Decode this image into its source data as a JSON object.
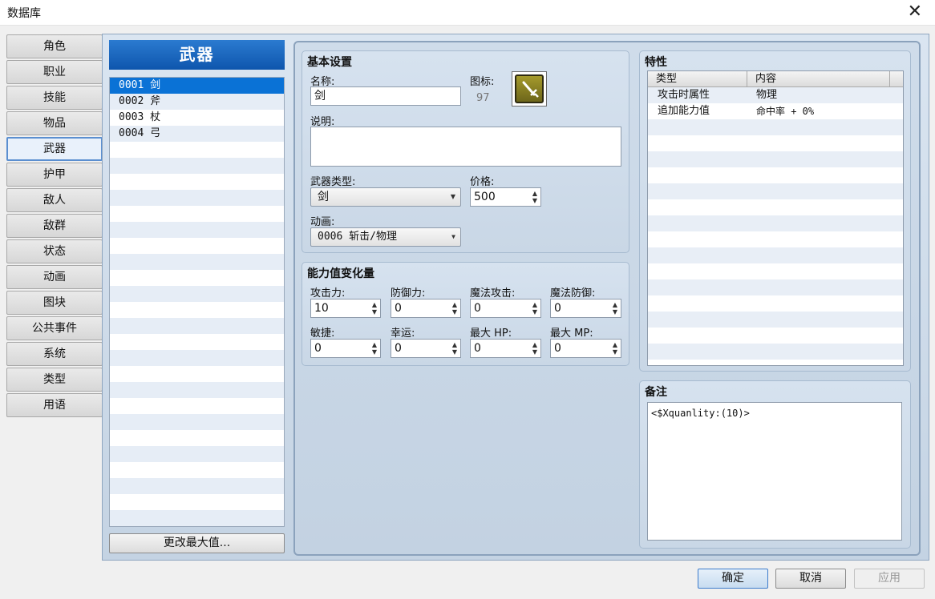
{
  "window": {
    "title": "数据库",
    "close_icon": "close-icon"
  },
  "tabs": [
    "角色",
    "职业",
    "技能",
    "物品",
    "武器",
    "护甲",
    "敌人",
    "敌群",
    "状态",
    "动画",
    "图块",
    "公共事件",
    "系统",
    "类型",
    "用语"
  ],
  "active_tab": "武器",
  "list": {
    "header": "武器",
    "items": [
      "0001 剑",
      "0002 斧",
      "0003 杖",
      "0004 弓"
    ],
    "selected_index": 0,
    "change_max_button": "更改最大值..."
  },
  "basic": {
    "title": "基本设置",
    "name_label": "名称:",
    "name_value": "剑",
    "icon_label": "图标:",
    "icon_index": "97",
    "icon_name": "sword-icon",
    "desc_label": "说明:",
    "desc_value": "",
    "weapon_type_label": "武器类型:",
    "weapon_type_value": "剑",
    "price_label": "价格:",
    "price_value": "500",
    "animation_label": "动画:",
    "animation_value": "0006 斩击/物理"
  },
  "params": {
    "title": "能力值变化量",
    "labels": [
      "攻击力:",
      "防御力:",
      "魔法攻击:",
      "魔法防御:",
      "敏捷:",
      "幸运:",
      "最大 HP:",
      "最大 MP:"
    ],
    "values": [
      "10",
      "0",
      "0",
      "0",
      "0",
      "0",
      "0",
      "0"
    ]
  },
  "traits": {
    "title": "特性",
    "col_type": "类型",
    "col_content": "内容",
    "rows": [
      {
        "type": "攻击时属性",
        "content": "物理"
      },
      {
        "type": "追加能力值",
        "content": "命中率 + 0%"
      }
    ]
  },
  "note": {
    "title": "备注",
    "value": "<$Xquanlity:(10)>"
  },
  "buttons": {
    "ok": "确定",
    "cancel": "取消",
    "apply": "应用"
  }
}
